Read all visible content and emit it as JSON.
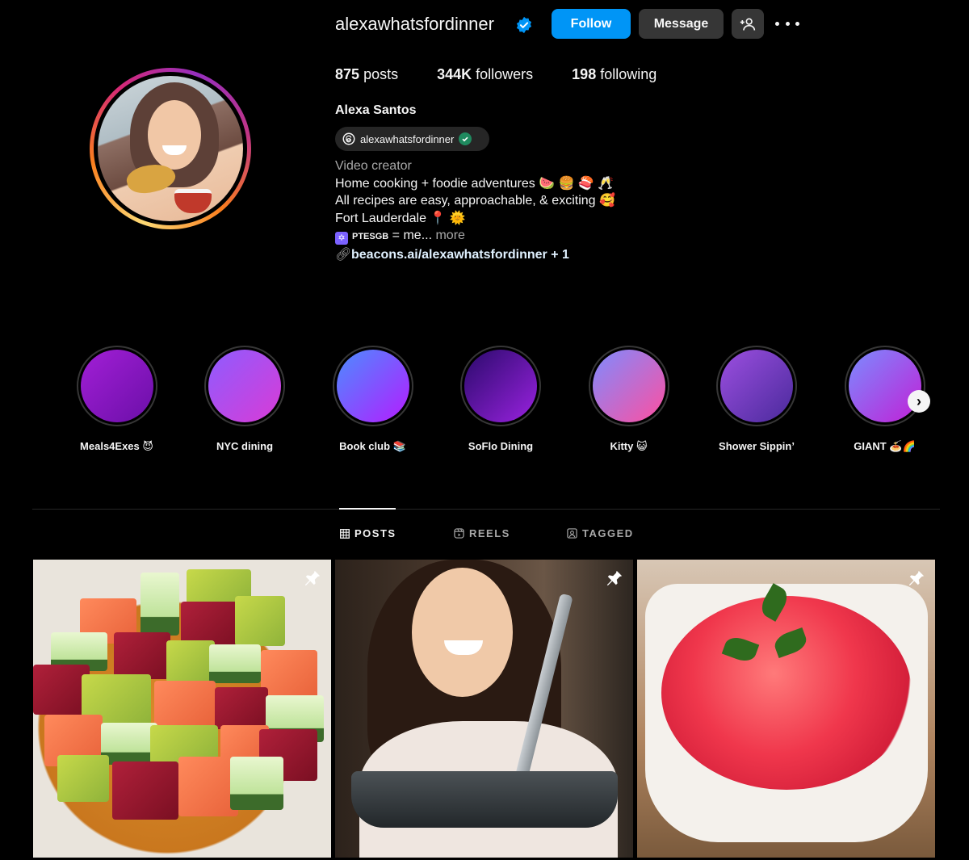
{
  "profile": {
    "username": "alexawhatsfordinner",
    "follow_label": "Follow",
    "message_label": "Message",
    "posts_count": "875",
    "posts_label": "posts",
    "followers_count": "344K",
    "followers_label": "followers",
    "following_count": "198",
    "following_label": "following",
    "full_name": "Alexa Santos",
    "threads_handle": "alexawhatsfordinner",
    "category": "Video creator",
    "bio_line1": "Home cooking + foodie adventures 🍉 🍔 🍣 🥂",
    "bio_line2": "All recipes are easy, approachable, & exciting 🥰",
    "bio_line3": "Fort Lauderdale 📍 🌞",
    "bio_line4_tag": "PTESGB",
    "bio_line4_text": " = me...",
    "bio_more": " more",
    "link_text": "beacons.ai/alexawhatsfordinner",
    "link_extra": " + 1"
  },
  "highlights": [
    {
      "label": "Meals4Exes 😈",
      "color_a": "#a21fd6",
      "color_b": "#6b0fa8"
    },
    {
      "label": "NYC dining",
      "color_a": "#8e5cff",
      "color_b": "#d93bd6"
    },
    {
      "label": "Book club 📚",
      "color_a": "#4b8dff",
      "color_b": "#b51cff"
    },
    {
      "label": "SoFlo Dining",
      "color_a": "#2a0a6b",
      "color_b": "#9a22e0"
    },
    {
      "label": "Kitty 😺",
      "color_a": "#7e8bff",
      "color_b": "#ff4fa0"
    },
    {
      "label": "Shower Sippin’",
      "color_a": "#9c4fe0",
      "color_b": "#4a2a9c"
    },
    {
      "label": "GIANT 🍝🌈",
      "color_a": "#7b8cff",
      "color_b": "#c21fd6"
    }
  ],
  "tabs": {
    "posts": "POSTS",
    "reels": "REELS",
    "tagged": "TAGGED"
  },
  "icons": [
    "verified-badge-icon",
    "add-person-icon",
    "more-icon",
    "threads-icon",
    "link-icon",
    "chevron-right-icon",
    "grid-icon",
    "reels-icon",
    "tagged-icon",
    "pin-icon"
  ],
  "colors": {
    "accent": "#0095f6",
    "background": "#000000",
    "button_dark": "#363636",
    "muted_text": "#a8a8a8"
  }
}
